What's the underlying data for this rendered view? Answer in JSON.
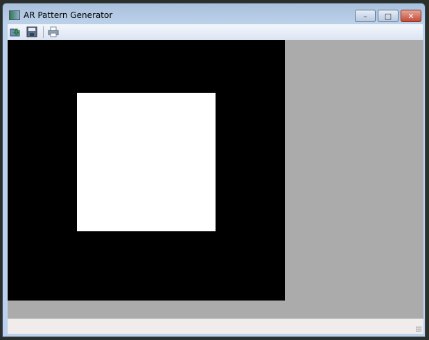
{
  "window": {
    "title": "AR Pattern Generator",
    "controls": {
      "minimize": "–",
      "maximize": "□",
      "close": "✕"
    }
  },
  "toolbar": {
    "items": [
      {
        "icon": "open-icon"
      },
      {
        "icon": "save-icon"
      },
      {
        "icon": "print-icon"
      }
    ]
  },
  "pattern": {
    "outer_color": "#000000",
    "inner_color": "#ffffff",
    "background": "#ababab"
  },
  "statusbar": {
    "text": ""
  }
}
